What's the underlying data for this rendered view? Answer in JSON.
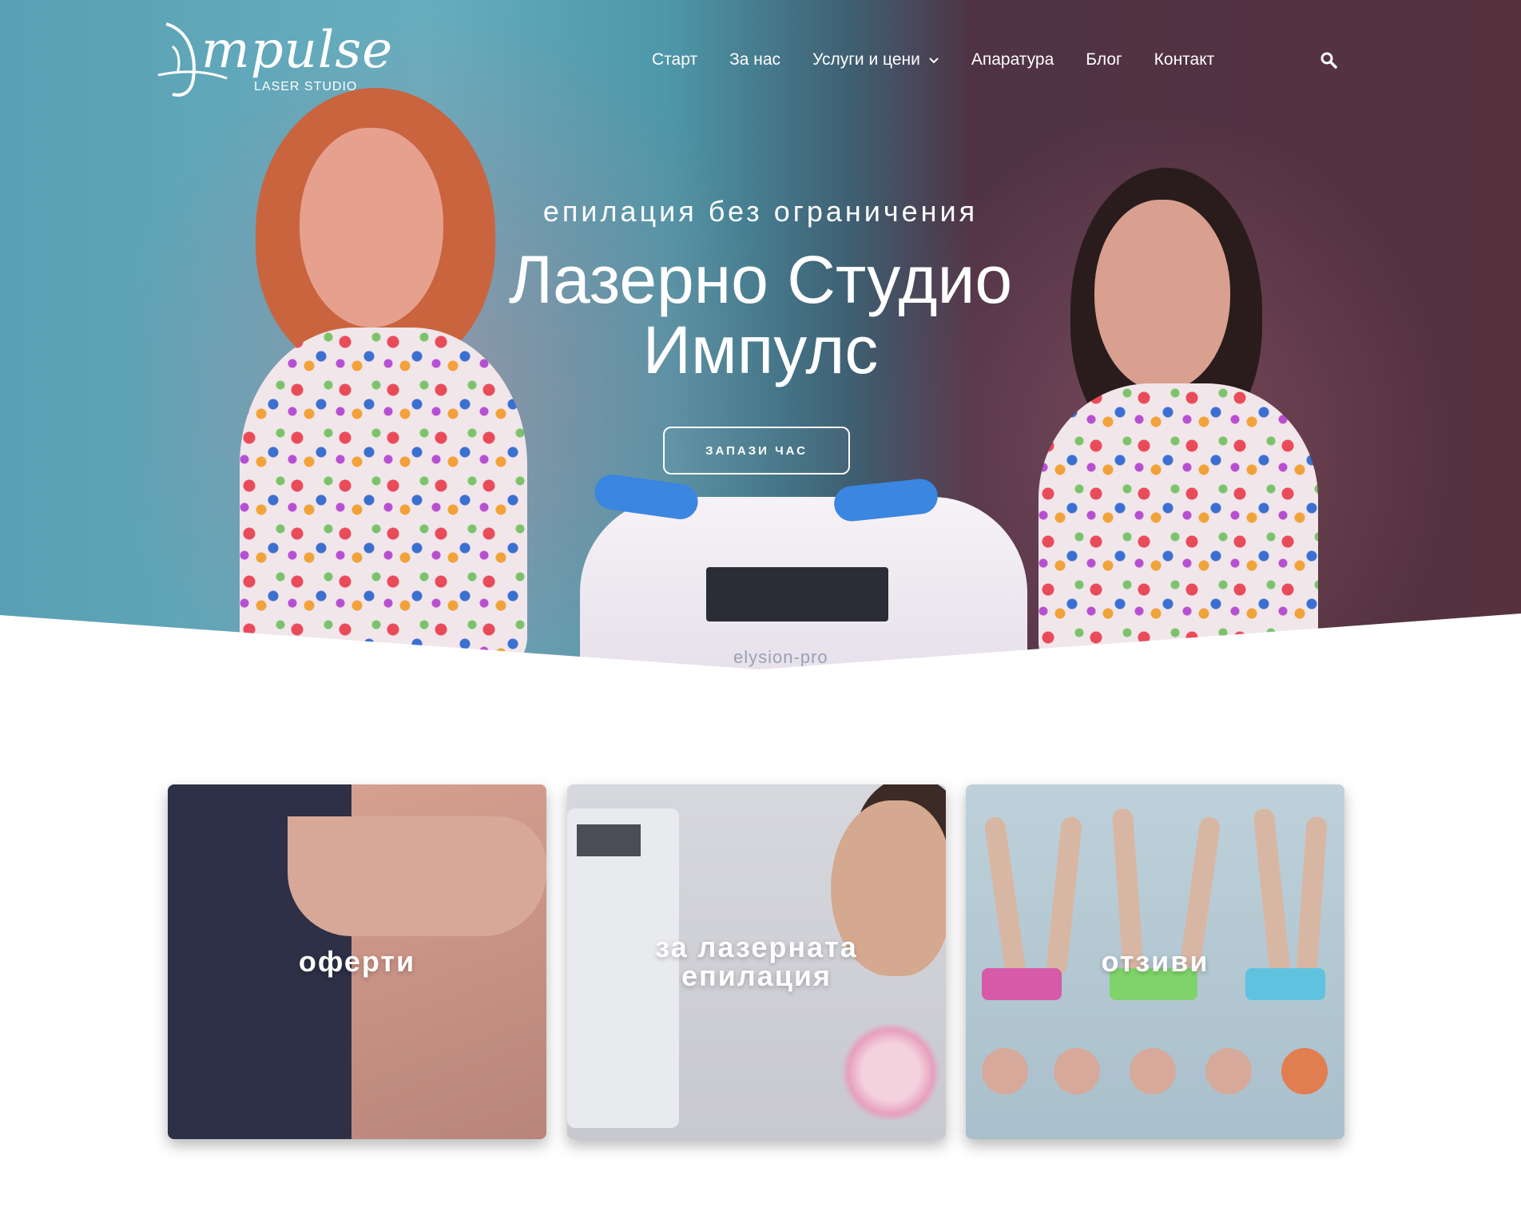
{
  "brand": {
    "logo_text": "mpulse",
    "logo_sub": "LASER STUDIO"
  },
  "nav": {
    "items": [
      {
        "label": "Старт"
      },
      {
        "label": "За нас"
      },
      {
        "label": "Услуги и цени",
        "has_dropdown": true
      },
      {
        "label": "Апаратура"
      },
      {
        "label": "Блог"
      },
      {
        "label": "Контакт"
      }
    ],
    "search_icon": "search-icon"
  },
  "hero": {
    "tagline": "епилация без ограничения",
    "title_line1": "Лазерно Студио",
    "title_line2": "Импулс",
    "cta": "ЗАПАЗИ ЧАС",
    "machine_brand": "elysion-pro",
    "colors": {
      "left": "#5a9fb3",
      "right": "#56323f"
    }
  },
  "cards": [
    {
      "label_line1": "оферти",
      "label_line2": ""
    },
    {
      "label_line1": "за лазерната",
      "label_line2": "епилация"
    },
    {
      "label_line1": "отзиви",
      "label_line2": ""
    }
  ]
}
